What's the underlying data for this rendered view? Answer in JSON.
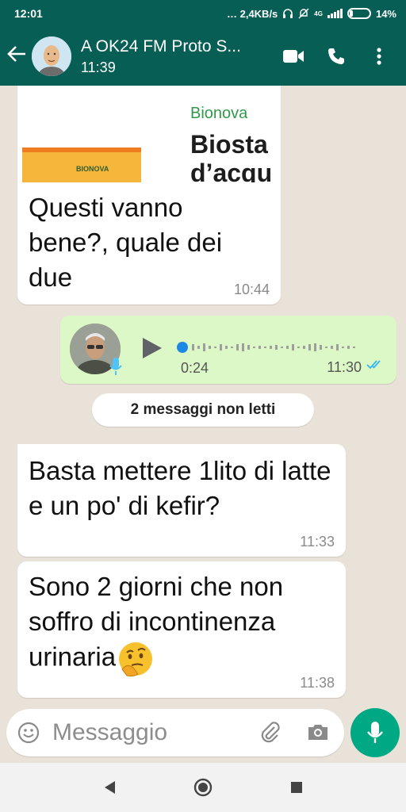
{
  "status_bar": {
    "time": "12:01",
    "network_speed": "… 2,4KB/s",
    "battery_percent": "14%",
    "network_type": "4G"
  },
  "header": {
    "title": "A OK24 FM Proto S...",
    "subtitle": "11:39",
    "icons": [
      "back-arrow-icon",
      "avatar",
      "video-call-icon",
      "voice-call-icon",
      "more-options-icon"
    ]
  },
  "messages": [
    {
      "type": "image_with_caption",
      "image_brand_small": "Bionova",
      "image_brand_big_line1": "Biosta",
      "image_brand_big_line2": "d’acqu",
      "image_box_label": "BIONOVA",
      "text": "Questi vanno bene?, quale dei due",
      "time": "10:44"
    },
    {
      "type": "voice",
      "duration": "0:24",
      "time": "11:30",
      "status": "read"
    },
    {
      "type": "text",
      "text": "Basta mettere 1lito di latte e un po' di kefir?",
      "time": "11:33"
    },
    {
      "type": "text",
      "text": "Sono 2 giorni che non soffro di incontinenza urinaria",
      "emoji": "thinking-face",
      "time": "11:38"
    }
  ],
  "unread_banner": "2 messaggi non letti",
  "input": {
    "placeholder": "Messaggio"
  },
  "colors": {
    "header": "#075e54",
    "outgoing_bubble": "#dcf8c6",
    "incoming_bubble": "#ffffff",
    "chat_background": "#e9e2d8",
    "fab": "#00a884",
    "read_ticks": "#34b7f1"
  }
}
